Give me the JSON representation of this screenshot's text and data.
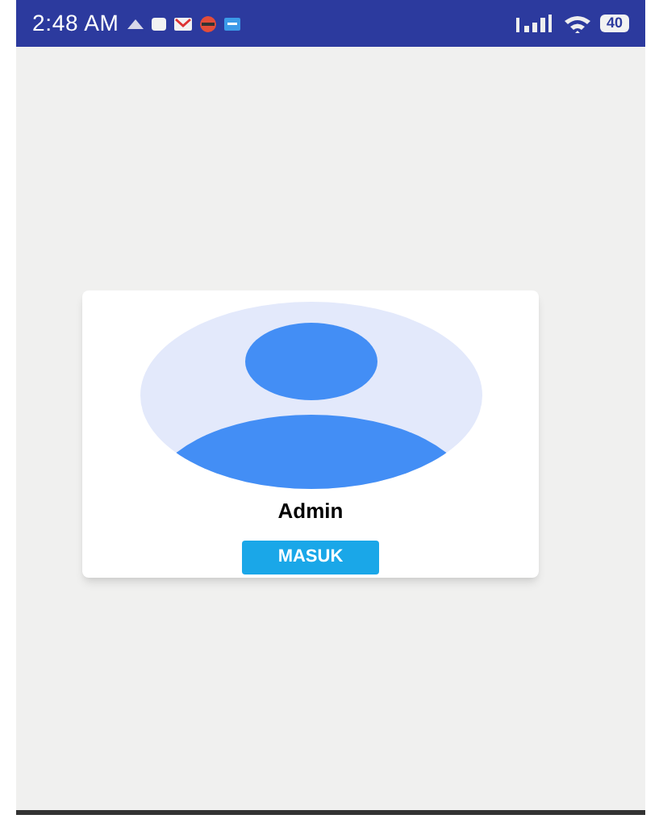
{
  "status_bar": {
    "time": "2:48 AM",
    "battery": "40"
  },
  "profile": {
    "name": "Admin"
  },
  "buttons": [
    "MASUK"
  ]
}
